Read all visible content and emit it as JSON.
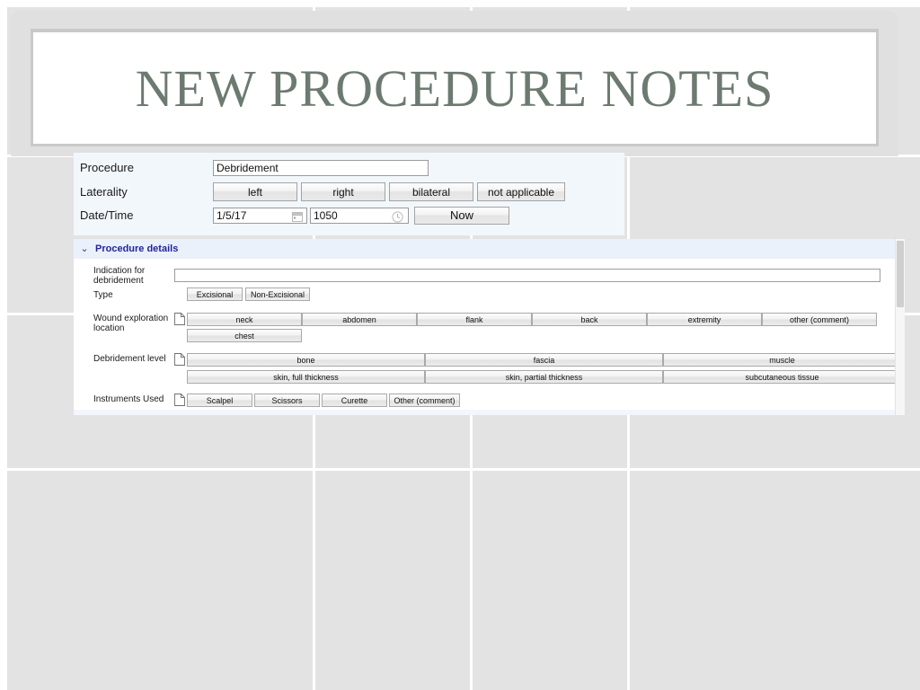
{
  "slide": {
    "title": "NEW PROCEDURE NOTES"
  },
  "top_form": {
    "procedure": {
      "label": "Procedure",
      "value": "Debridement",
      "placeholder": ""
    },
    "laterality": {
      "label": "Laterality",
      "options": [
        "left",
        "right",
        "bilateral",
        "not applicable"
      ]
    },
    "datetime": {
      "label": "Date/Time",
      "date_value": "1/5/17",
      "date_icon": "calendar-icon",
      "time_value": "1050",
      "time_icon": "clock-icon",
      "now_label": "Now"
    }
  },
  "details": {
    "chevron_icon": "chevron-down-icon",
    "header": "Procedure details",
    "rows": {
      "indication": {
        "label": "Indication for debridement",
        "value": ""
      },
      "type": {
        "label": "Type",
        "options": [
          "Excisional",
          "Non-Excisional"
        ]
      },
      "wound_location": {
        "label": "Wound exploration location",
        "icon": "document-icon",
        "options_row1": [
          "neck",
          "abdomen",
          "flank",
          "back",
          "extremity",
          "other (comment)"
        ],
        "options_row2": [
          "chest"
        ]
      },
      "debridement_level": {
        "label": "Debridement level",
        "icon": "document-icon",
        "options_row1": [
          "bone",
          "fascia",
          "muscle"
        ],
        "options_row2": [
          "skin, full thickness",
          "skin, partial thickness",
          "subcutaneous tissue"
        ]
      },
      "instruments": {
        "label": "Instruments Used",
        "icon": "document-icon",
        "options": [
          "Scalpel",
          "Scissors",
          "Curette",
          "Other (comment)"
        ]
      }
    },
    "scrollbar": "vertical-scrollbar"
  },
  "colors": {
    "title_text": "#6c7a70",
    "panel_header_text": "#24249a",
    "form_background": "#f2f7fc",
    "slide_background": "#e3e3e3"
  }
}
